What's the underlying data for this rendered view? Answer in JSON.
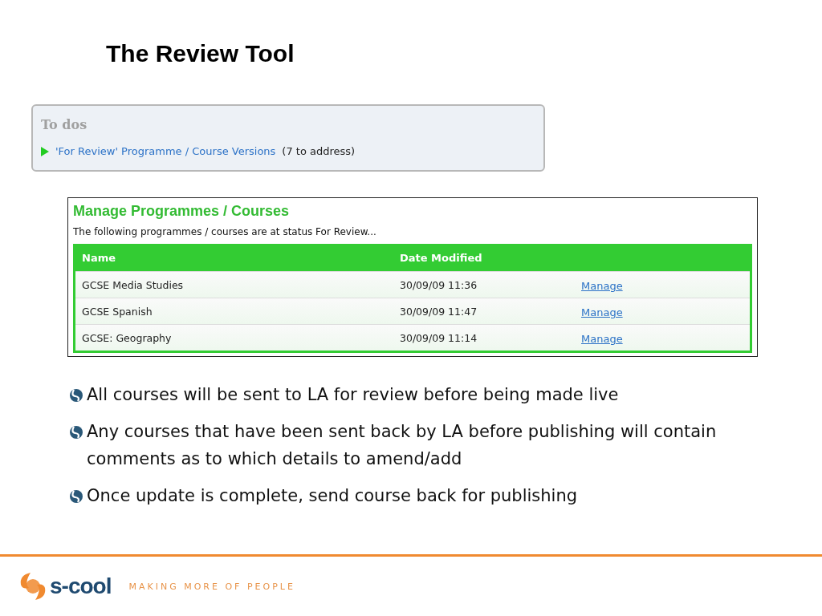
{
  "title": "The Review Tool",
  "todos": {
    "heading": "To dos",
    "link": "'For Review' Programme / Course Versions",
    "count": "(7 to address)"
  },
  "manage": {
    "heading": "Manage Programmes / Courses",
    "intro": "The following programmes / courses are at status For Review...",
    "columns": [
      "Name",
      "Date Modified"
    ],
    "rows": [
      {
        "name": "GCSE Media Studies",
        "date": "30/09/09 11:36",
        "action": "Manage"
      },
      {
        "name": "GCSE Spanish",
        "date": "30/09/09 11:47",
        "action": "Manage"
      },
      {
        "name": "GCSE: Geography",
        "date": "30/09/09 11:14",
        "action": "Manage"
      }
    ]
  },
  "bullets": [
    "All courses will be sent to LA for review before being made live",
    "Any courses that have been sent back by LA before publishing will contain comments as to which details to amend/add",
    "Once update is complete, send course back for publishing"
  ],
  "footer": {
    "logo_text": "s-cool",
    "tagline": "MAKING MORE OF PEOPLE"
  }
}
